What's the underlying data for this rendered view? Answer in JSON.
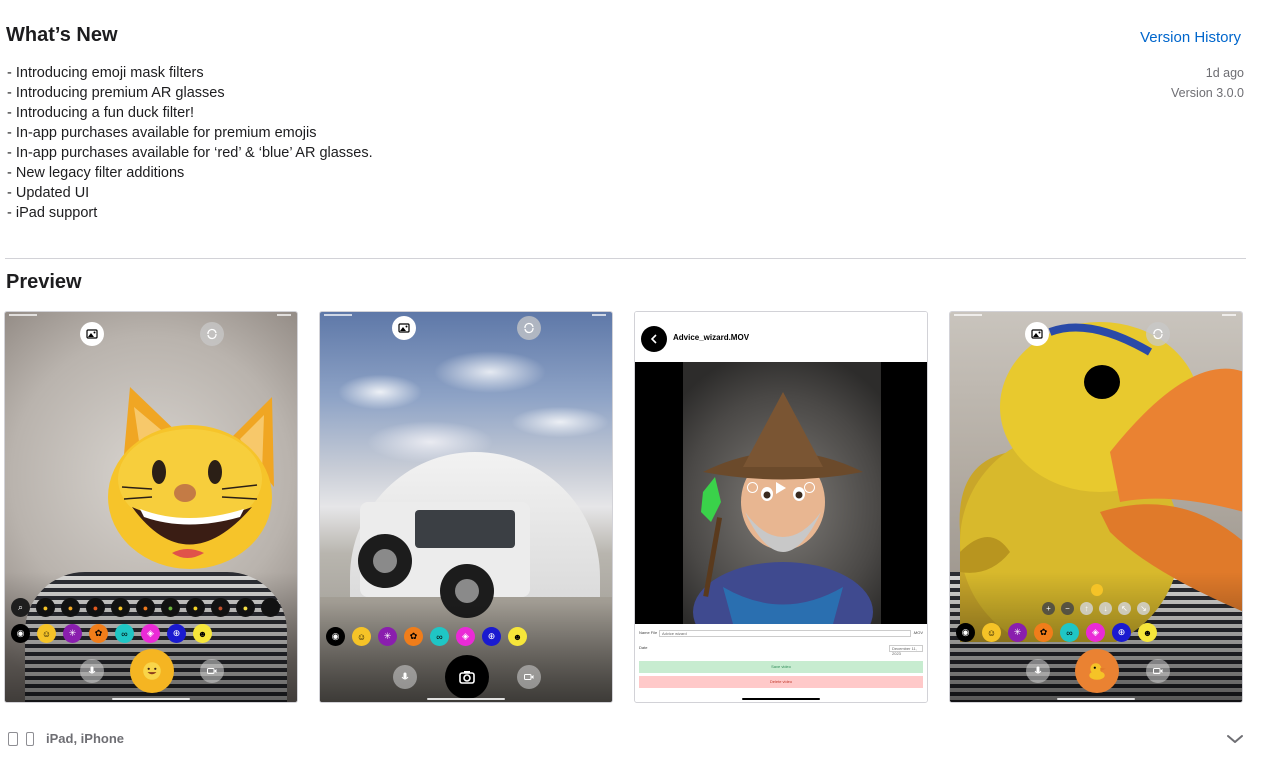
{
  "whats_new": {
    "title": "What’s New",
    "version_history_link": "Version History",
    "notes": [
      "- Introducing emoji mask filters",
      "- Introducing premium AR glasses",
      "- Introducing a fun duck filter!",
      "- In-app purchases available for premium emojis",
      "- In-app purchases available for ‘red’ & ‘blue’ AR glasses.",
      "- New legacy filter additions",
      "- Updated UI",
      "- iPad support"
    ],
    "time_ago": "1d ago",
    "version": "Version 3.0.0"
  },
  "preview": {
    "title": "Preview",
    "screenshots": [
      {
        "subject": "cat emoji mask filter",
        "icons": [
          "gallery-icon",
          "flip-camera-icon",
          "microphone-icon",
          "video-icon"
        ]
      },
      {
        "subject": "jeep in front of dome building",
        "icons": [
          "gallery-icon",
          "flip-camera-icon",
          "microphone-icon",
          "camera-icon",
          "video-icon"
        ]
      },
      {
        "subject": "wizard video playback",
        "video_title": "Advice_wizard.MOV",
        "form": {
          "name_label": "Name File",
          "name_value": "Advice wizard",
          "extension": ".MOV",
          "date_label": "Date",
          "date_value": "December 11, 2023",
          "save_label": "Save video",
          "delete_label": "Delete video"
        }
      },
      {
        "subject": "duck filter",
        "icons": [
          "gallery-icon",
          "flip-camera-icon",
          "microphone-icon",
          "video-icon"
        ]
      }
    ],
    "emoji_filters": [
      "camera",
      "smiley",
      "sparkle",
      "flower",
      "glasses",
      "sticker",
      "globe",
      "smiley"
    ],
    "cat_filters": [
      "zoom",
      "cat",
      "cat",
      "devil",
      "cat",
      "cat",
      "frog",
      "bell",
      "devil",
      "chick",
      "dot"
    ],
    "colors": {
      "yellow": "#f5c327",
      "purple": "#8a1eae",
      "orange": "#f07d1a",
      "teal": "#1fc6c5",
      "magenta": "#ea2ad6",
      "blue": "#1a1ad0",
      "light_yellow": "#f6e63a",
      "duck_orange": "#ea8232"
    }
  },
  "footer": {
    "devices": "iPad, iPhone"
  }
}
